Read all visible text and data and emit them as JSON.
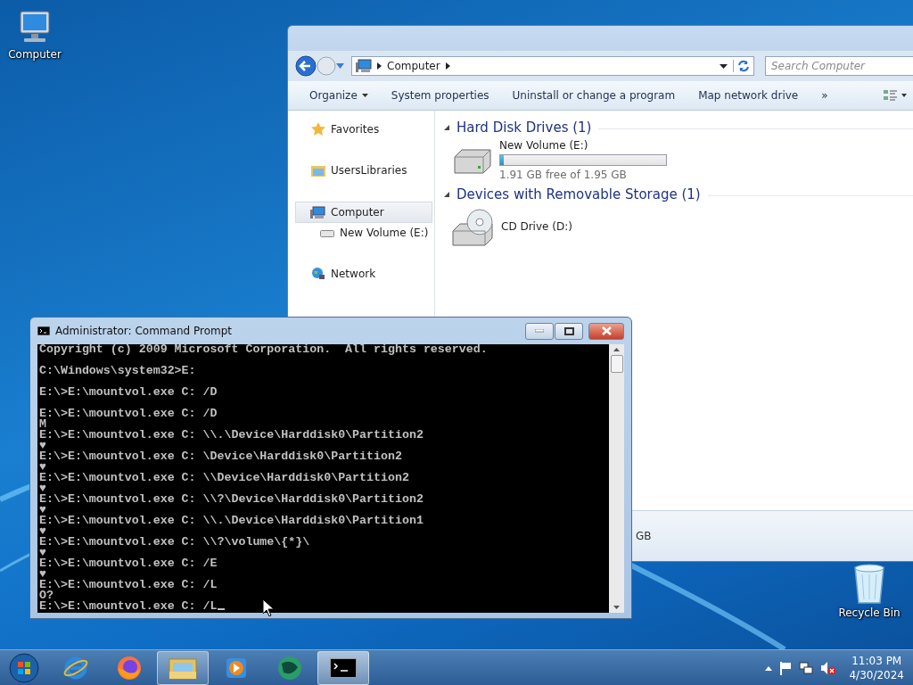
{
  "desktop_icons": [
    {
      "kind": "computer",
      "label": "Computer"
    },
    {
      "kind": "recycle",
      "label": "Recycle Bin"
    }
  ],
  "explorer": {
    "address": [
      "Computer"
    ],
    "search": {
      "placeholder": "Search Computer"
    },
    "toolbar": [
      {
        "label": "Organize",
        "dropdown": true
      },
      {
        "label": "System properties",
        "dropdown": false
      },
      {
        "label": "Uninstall or change a program",
        "dropdown": false
      },
      {
        "label": "Map network drive",
        "dropdown": false
      },
      {
        "label": "»",
        "dropdown": false
      }
    ],
    "nav": [
      {
        "kind": "star",
        "label": "Favorites",
        "selected": false
      },
      {
        "kind": "library",
        "label": "UsersLibraries",
        "selected": false
      },
      {
        "kind": "computer",
        "label": "Computer",
        "selected": true,
        "children": [
          {
            "kind": "drive",
            "label": "New Volume (E:)",
            "selected": false
          }
        ]
      },
      {
        "kind": "network",
        "label": "Network",
        "selected": false
      }
    ],
    "sections": [
      {
        "title": "Hard Disk Drives (1)",
        "items": [
          {
            "kind": "disk",
            "name": "New Volume (E:)",
            "level": 0.02,
            "free": "1.91 GB free of 1.95 GB"
          }
        ]
      },
      {
        "title": "Devices with Removable Storage (1)",
        "items": [
          {
            "kind": "cd",
            "name": "CD Drive (D:)"
          }
        ]
      }
    ],
    "details_text": "GB"
  },
  "cmd": {
    "title": "Administrator: Command Prompt",
    "lines": [
      {
        "text": "Copyright (c) 2009 Microsoft Corporation.  All rights reserved.",
        "blank_after": true
      },
      {
        "text": "C:\\Windows\\system32>E:",
        "blank_after": true
      },
      {
        "text": "E:\\>E:\\mountvol.exe C: /D",
        "blank_after": true
      },
      {
        "text": "E:\\>E:\\mountvol.exe C: /D",
        "blank_after": false
      },
      {
        "text": "M",
        "blank_after": false
      },
      {
        "text": "E:\\>E:\\mountvol.exe C: \\\\.\\Device\\Harddisk0\\Partition2",
        "blank_after": false
      },
      {
        "text": "♥",
        "blank_after": false
      },
      {
        "text": "E:\\>E:\\mountvol.exe C: \\Device\\Harddisk0\\Partition2",
        "blank_after": false
      },
      {
        "text": "♥",
        "blank_after": false
      },
      {
        "text": "E:\\>E:\\mountvol.exe C: \\\\Device\\Harddisk0\\Partition2",
        "blank_after": false
      },
      {
        "text": "♥",
        "blank_after": false
      },
      {
        "text": "E:\\>E:\\mountvol.exe C: \\\\?\\Device\\Harddisk0\\Partition2",
        "blank_after": false
      },
      {
        "text": "♥",
        "blank_after": false
      },
      {
        "text": "E:\\>E:\\mountvol.exe C: \\\\.\\Device\\Harddisk0\\Partition1",
        "blank_after": false
      },
      {
        "text": "♥",
        "blank_after": false
      },
      {
        "text": "E:\\>E:\\mountvol.exe C: \\\\?\\volume\\{*}\\",
        "blank_after": false
      },
      {
        "text": "♥",
        "blank_after": false
      },
      {
        "text": "E:\\>E:\\mountvol.exe C: /E",
        "blank_after": false
      },
      {
        "text": "♥",
        "blank_after": false
      },
      {
        "text": "E:\\>E:\\mountvol.exe C: /L",
        "blank_after": false
      },
      {
        "text": "O?",
        "blank_after": false
      },
      {
        "text": "E:\\>E:\\mountvol.exe C: /L",
        "blank_after": false
      }
    ]
  },
  "taskbar": {
    "apps": [
      {
        "kind": "ie",
        "open": false,
        "selected": false
      },
      {
        "kind": "firefox",
        "open": false,
        "selected": false
      },
      {
        "kind": "explorer",
        "open": true,
        "selected": false
      },
      {
        "kind": "media",
        "open": false,
        "selected": false
      },
      {
        "kind": "globe",
        "open": false,
        "selected": false
      },
      {
        "kind": "cmd",
        "open": true,
        "selected": true
      }
    ],
    "time": "11:03 PM",
    "date": "4/30/2024"
  }
}
